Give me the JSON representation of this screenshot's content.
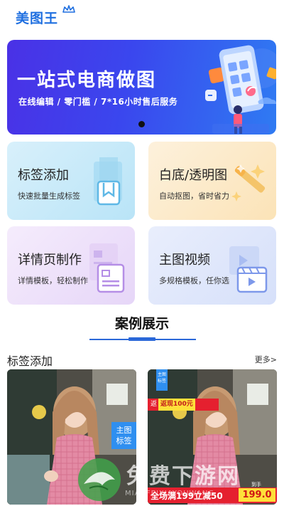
{
  "app": {
    "logo_text": "美图王"
  },
  "banner": {
    "title": "一站式电商做图",
    "subtitle": "在线编辑 / 零门槛 / 7*16小时售后服务",
    "page_indicator": "1"
  },
  "features": [
    {
      "title": "标签添加",
      "desc": "快速批量生成标签",
      "icon": "bookmark-icon"
    },
    {
      "title": "白底/透明图",
      "desc": "自动抠图，省时省力",
      "icon": "magic-wand-icon"
    },
    {
      "title": "详情页制作",
      "desc": "详情模板，轻松制作",
      "icon": "document-icon"
    },
    {
      "title": "主图视频",
      "desc": "多规格模板，任你选",
      "icon": "video-icon"
    }
  ],
  "showcase": {
    "title": "案例展示",
    "category": "标签添加",
    "more_label": "更多>",
    "cases": [
      {
        "tag": "主图\n标签"
      },
      {
        "tag": "主图\n标签",
        "promo_top": "返",
        "promo_top_badge": "返现100元",
        "promo_bottom": "全场满199立减50",
        "price_label": "到手",
        "price": "199.0"
      }
    ]
  },
  "watermark": {
    "text": "免费下游网",
    "sub": "MIANFEIXIAYOUWANG"
  },
  "colors": {
    "brand": "#1f6fe0",
    "accent": "#2b68d9",
    "promo_red": "#e5202f",
    "promo_yellow": "#ffe03a"
  }
}
